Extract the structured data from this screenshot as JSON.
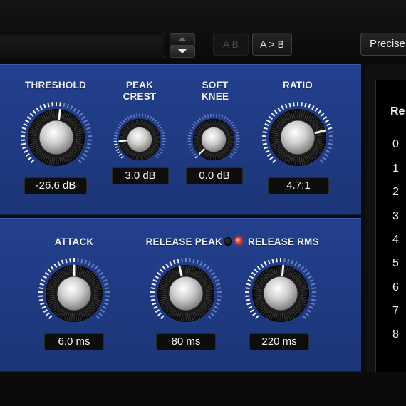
{
  "toolbar": {
    "preset_value": "",
    "ab_disabled_label": "A B",
    "ab_copy_label": "A > B",
    "precise_label": "Precise"
  },
  "knobs": {
    "threshold": {
      "label": "THRESHOLD",
      "value": "-26.6 dB"
    },
    "peak_crest": {
      "label": "PEAK\nCREST",
      "value": "3.0 dB"
    },
    "soft_knee": {
      "label": "SOFT\nKNEE",
      "value": "0.0 dB"
    },
    "ratio": {
      "label": "RATIO",
      "value": "4.7:1"
    },
    "attack": {
      "label": "ATTACK",
      "value": "6.0 ms"
    },
    "release_peak": {
      "label": "RELEASE PEAK",
      "value": "80 ms"
    },
    "release_rms": {
      "label": "RELEASE RMS",
      "value": "220 ms"
    }
  },
  "release_led": {
    "active": "rms"
  },
  "right_list": {
    "header": "Re",
    "items": [
      "0",
      "1",
      "2",
      "3",
      "4",
      "5",
      "6",
      "7",
      "8"
    ]
  },
  "colors": {
    "panel_blue": "#24408e",
    "led_active": "#ff3a20"
  }
}
